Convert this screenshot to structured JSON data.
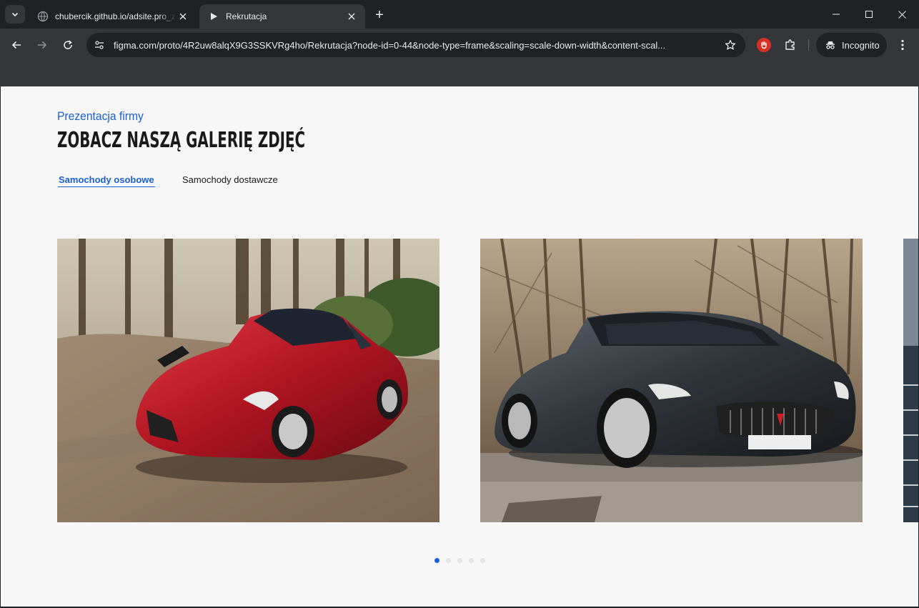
{
  "browser": {
    "tabs": [
      {
        "title": "chubercik.github.io/adsite.pro_zadanie",
        "favicon": "globe-icon",
        "active": false
      },
      {
        "title": "Rekrutacja",
        "favicon": "figma-play-icon",
        "active": true
      }
    ],
    "new_tab_label": "+",
    "url": "figma.com/proto/4R2uw8alqX9G3SSKVRg4ho/Rekrutacja?node-id=0-44&node-type=frame&scaling=scale-down-width&content-scal...",
    "incognito_label": "Incognito",
    "colors": {
      "frame": "#202124",
      "toolbar": "#35363a",
      "text": "#e8eaed"
    }
  },
  "page": {
    "eyebrow": "Prezentacja firmy",
    "heading": "ZOBACZ NASZĄ GALERIĘ ZDJĘĆ",
    "tabs": [
      {
        "label": "Samochody osobowe",
        "active": true
      },
      {
        "label": "Samochody dostawcze",
        "active": false
      }
    ],
    "gallery": {
      "images": [
        {
          "subject": "red sports coupe driving on forest road"
        },
        {
          "subject": "dark grey convertible grand tourer parked by trees"
        },
        {
          "subject": "partially visible next photo"
        }
      ],
      "pagination": {
        "total": 5,
        "current": 1
      }
    },
    "colors": {
      "accent": "#1a5fd8",
      "background": "#f7f7f7",
      "heading": "#1a1a1a",
      "dot_inactive": "#e4e4e4"
    }
  }
}
